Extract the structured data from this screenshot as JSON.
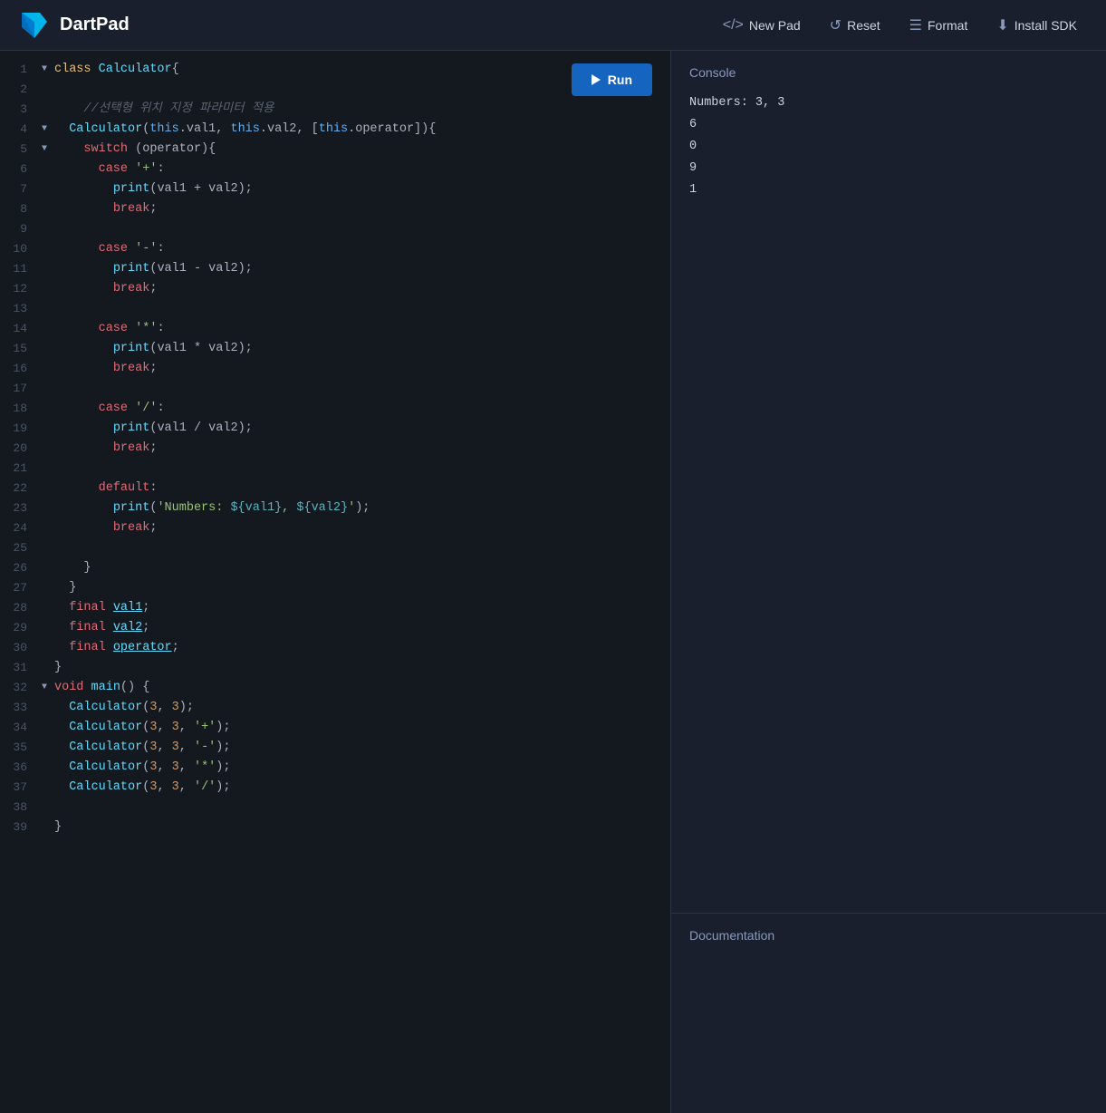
{
  "header": {
    "logo_text": "DartPad",
    "new_pad_label": "New Pad",
    "reset_label": "Reset",
    "format_label": "Format",
    "install_sdk_label": "Install SDK"
  },
  "editor": {
    "run_label": "Run",
    "lines": [
      {
        "num": 1,
        "fold": "▼",
        "content": "<cls>class</cls> <fn>Calculator</fn><punct>{</punct>"
      },
      {
        "num": 2,
        "fold": "",
        "content": ""
      },
      {
        "num": 3,
        "fold": "",
        "content": "    <comment>//선택형 위치 지정 파라미터 적용</comment>"
      },
      {
        "num": 4,
        "fold": "▼",
        "content": "  <fn>Calculator</fn><punct>(</punct><kw2>this</kw2><punct>.</punct><var>val1</var><punct>,</punct> <kw2>this</kw2><punct>.</punct><var>val2</var><punct>,</punct> <punct>[</punct><kw2>this</kw2><punct>.</punct><var>operator</var><punct>]){</punct>"
      },
      {
        "num": 5,
        "fold": "▼",
        "content": "    <kw>switch</kw> <punct>(</punct><var>operator</var><punct>){</punct>"
      },
      {
        "num": 6,
        "fold": "",
        "content": "      <kw>case</kw> <str>'+'</str><punct>:</punct>"
      },
      {
        "num": 7,
        "fold": "",
        "content": "        <fn>print</fn><punct>(</punct><var>val1</var> <punct>+</punct> <var>val2</var><punct>);</punct>"
      },
      {
        "num": 8,
        "fold": "",
        "content": "        <kw>break</kw><punct>;</punct>"
      },
      {
        "num": 9,
        "fold": "",
        "content": ""
      },
      {
        "num": 10,
        "fold": "",
        "content": "      <kw>case</kw> <str>'-'</str><punct>:</punct>"
      },
      {
        "num": 11,
        "fold": "",
        "content": "        <fn>print</fn><punct>(</punct><var>val1</var> <punct>-</punct> <var>val2</var><punct>);</punct>"
      },
      {
        "num": 12,
        "fold": "",
        "content": "        <kw>break</kw><punct>;</punct>"
      },
      {
        "num": 13,
        "fold": "",
        "content": ""
      },
      {
        "num": 14,
        "fold": "",
        "content": "      <kw>case</kw> <str>'*'</str><punct>:</punct>"
      },
      {
        "num": 15,
        "fold": "",
        "content": "        <fn>print</fn><punct>(</punct><var>val1</var> <punct>*</punct> <var>val2</var><punct>);</punct>"
      },
      {
        "num": 16,
        "fold": "",
        "content": "        <kw>break</kw><punct>;</punct>"
      },
      {
        "num": 17,
        "fold": "",
        "content": ""
      },
      {
        "num": 18,
        "fold": "",
        "content": "      <kw>case</kw> <str>'/'</str><punct>:</punct>"
      },
      {
        "num": 19,
        "fold": "",
        "content": "        <fn>print</fn><punct>(</punct><var>val1</var> <punct>/</punct> <var>val2</var><punct>);</punct>"
      },
      {
        "num": 20,
        "fold": "",
        "content": "        <kw>break</kw><punct>;</punct>"
      },
      {
        "num": 21,
        "fold": "",
        "content": ""
      },
      {
        "num": 22,
        "fold": "",
        "content": "      <kw>default</kw><punct>:</punct>"
      },
      {
        "num": 23,
        "fold": "",
        "content": "        <fn>print</fn><punct>(</punct><str>'Numbers: <interp>${val1}</interp>, <interp>${val2}</interp>'</str><punct>);</punct>"
      },
      {
        "num": 24,
        "fold": "",
        "content": "        <kw>break</kw><punct>;</punct>"
      },
      {
        "num": 25,
        "fold": "",
        "content": ""
      },
      {
        "num": 26,
        "fold": "",
        "content": "    <punct>}</punct>"
      },
      {
        "num": 27,
        "fold": "",
        "content": "  <punct>}</punct>"
      },
      {
        "num": 28,
        "fold": "",
        "content": "  <kw>final</kw> <fn class='underline'>val1</fn><punct>;</punct>"
      },
      {
        "num": 29,
        "fold": "",
        "content": "  <kw>final</kw> <fn class='underline'>val2</fn><punct>;</punct>"
      },
      {
        "num": 30,
        "fold": "",
        "content": "  <kw>final</kw> <fn class='underline'>operator</fn><punct>;</punct>"
      },
      {
        "num": 31,
        "fold": "",
        "content": "<punct>}</punct>"
      },
      {
        "num": 32,
        "fold": "▼",
        "content": "<kw>void</kw> <fn>main</fn><punct>() {</punct>"
      },
      {
        "num": 33,
        "fold": "",
        "content": "  <fn>Calculator</fn><punct>(</punct><num>3</num><punct>,</punct> <num>3</num><punct>);</punct>"
      },
      {
        "num": 34,
        "fold": "",
        "content": "  <fn>Calculator</fn><punct>(</punct><num>3</num><punct>,</punct> <num>3</num><punct>,</punct> <str>'+'</str><punct>);</punct>"
      },
      {
        "num": 35,
        "fold": "",
        "content": "  <fn>Calculator</fn><punct>(</punct><num>3</num><punct>,</punct> <num>3</num><punct>,</punct> <str>'-'</str><punct>);</punct>"
      },
      {
        "num": 36,
        "fold": "",
        "content": "  <fn>Calculator</fn><punct>(</punct><num>3</num><punct>,</punct> <num>3</num><punct>,</punct> <str>'*'</str><punct>);</punct>"
      },
      {
        "num": 37,
        "fold": "",
        "content": "  <fn>Calculator</fn><punct>(</punct><num>3</num><punct>,</punct> <num>3</num><punct>,</punct> <str>'/'</str><punct>);</punct>"
      },
      {
        "num": 38,
        "fold": "",
        "content": ""
      },
      {
        "num": 39,
        "fold": "",
        "content": "<punct>}</punct>"
      }
    ]
  },
  "console": {
    "title": "Console",
    "output": [
      "Numbers: 3, 3",
      "6",
      "0",
      "9",
      "1"
    ]
  },
  "documentation": {
    "title": "Documentation"
  }
}
